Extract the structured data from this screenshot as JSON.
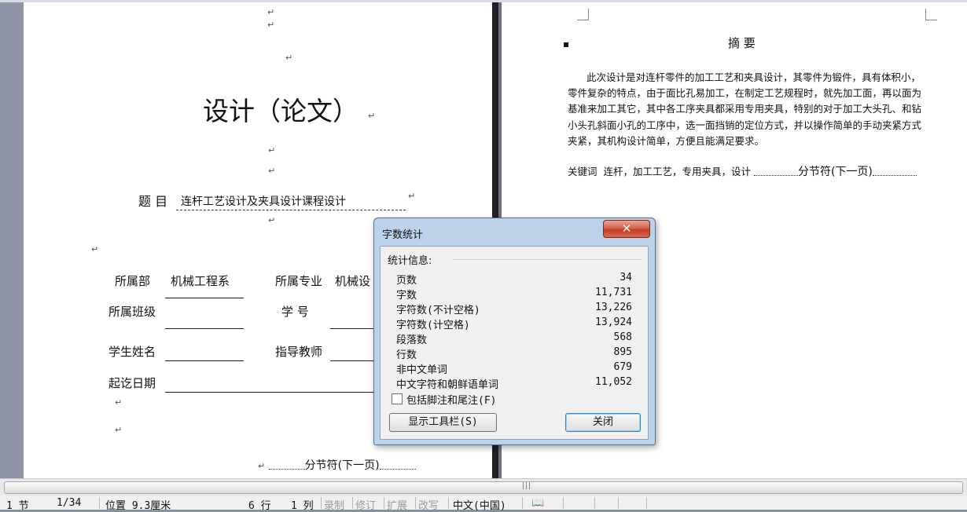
{
  "left_page": {
    "title": "设计（论文）",
    "topic_label": "题 目",
    "topic_value": "连杆工艺设计及夹具设计课程设计",
    "dept_label": "所属部",
    "dept_value": "机械工程系",
    "major_label": "所属专业",
    "major_value": "机械设",
    "class_label": "所属班级",
    "student_no_label": "学   号",
    "student_name_label": "学生姓名",
    "advisor_label": "指导教师",
    "date_label": "起讫日期",
    "section_break": "分节符(下一页)",
    "para_mark": "↵"
  },
  "right_page": {
    "heading": "摘  要",
    "abstract": "此次设计是对连杆零件的加工工艺和夹具设计，其零件为锻件，具有体积小，零件复杂的特点，由于面比孔易加工，在制定工艺规程时，就先加工面，再以面为基准来加工其它，其中各工序夹具都采用专用夹具，特别的对于加工大头孔、和钻小头孔斜面小孔的工序中，选一面挡销的定位方式，并以操作简单的手动夹紧方式夹紧，其机构设计简单，方便且能满足要求。",
    "keywords_label": "关键词",
    "keywords": "连杆，加工工艺，专用夹具，设计",
    "section_break": "分节符(下一页)"
  },
  "dialog": {
    "title": "字数统计",
    "close_glyph": "✕",
    "group_label": "统计信息:",
    "stats": [
      {
        "label": "页数",
        "value": "34"
      },
      {
        "label": "字数",
        "value": "11,731"
      },
      {
        "label": "字符数(不计空格)",
        "value": "13,226"
      },
      {
        "label": "字符数(计空格)",
        "value": "13,924"
      },
      {
        "label": "段落数",
        "value": "568"
      },
      {
        "label": "行数",
        "value": "895"
      },
      {
        "label": "非中文单词",
        "value": "679"
      },
      {
        "label": "中文字符和朝鲜语单词",
        "value": "11,052"
      }
    ],
    "include_footnotes_label": "包括脚注和尾注(F)",
    "include_footnotes_checked": false,
    "show_toolbar_label": "显示工具栏(S)",
    "close_label": "关闭"
  },
  "status_bar": {
    "section": "1 节",
    "page": "1/34",
    "position": "位置 9.3厘米",
    "line": "6 行",
    "column": "1 列",
    "record": "录制",
    "revise": "修订",
    "extend": "扩展",
    "overwrite": "改写",
    "language": "中文(中国)"
  },
  "colors": {
    "dialog_frame": "#bcd1ea",
    "close_button": "#c33d22",
    "workspace": "#8a8fa8"
  }
}
